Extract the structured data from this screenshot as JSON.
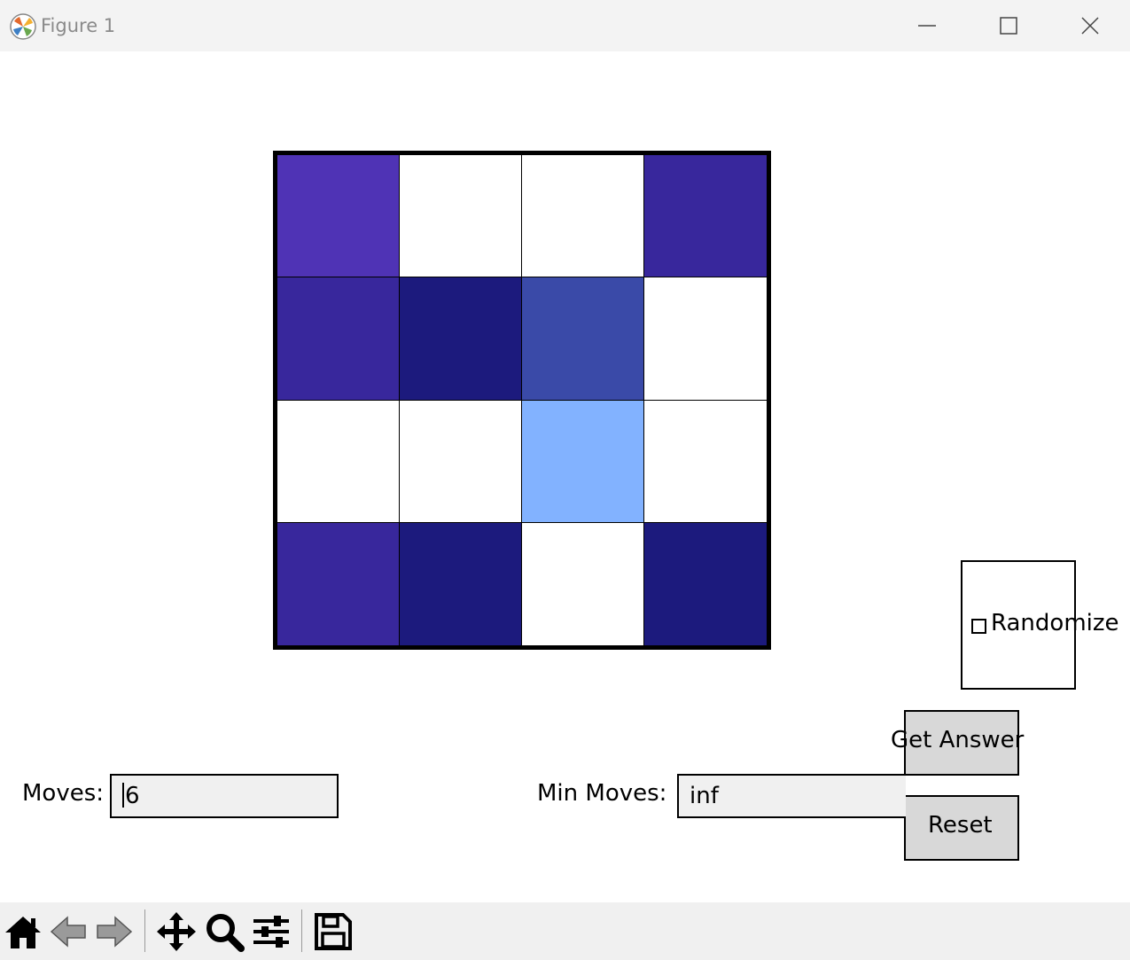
{
  "window": {
    "title": "Figure 1",
    "app_icon": "matplotlib-icon",
    "controls": [
      "minimize-icon",
      "maximize-icon",
      "close-icon"
    ]
  },
  "board": {
    "rows": 4,
    "cols": 4,
    "cells": [
      [
        "#4f33b5",
        "#ffffff",
        "#ffffff",
        "#38279c"
      ],
      [
        "#38279c",
        "#1c1a7d",
        "#3a4aa8",
        "#ffffff"
      ],
      [
        "#ffffff",
        "#ffffff",
        "#82b2ff",
        "#ffffff"
      ],
      [
        "#38279c",
        "#1c1a7d",
        "#ffffff",
        "#1c1a7d"
      ]
    ]
  },
  "controls": {
    "randomize_label": "Randomize",
    "randomize_checked": false,
    "get_answer_label": "Get Answer",
    "reset_label": "Reset",
    "moves_label": "Moves:",
    "moves_value": "6",
    "min_moves_label": "Min Moves:",
    "min_moves_value": "inf"
  },
  "colors": {
    "button_bg": "#d8d8d8",
    "field_bg": "#f0f0f0",
    "toolbar_bg": "#f0f0f0"
  },
  "toolbar": {
    "icons": [
      "home-icon",
      "back-icon",
      "forward-icon",
      "pan-icon",
      "zoom-icon",
      "configure-subplots-icon",
      "save-icon"
    ]
  }
}
